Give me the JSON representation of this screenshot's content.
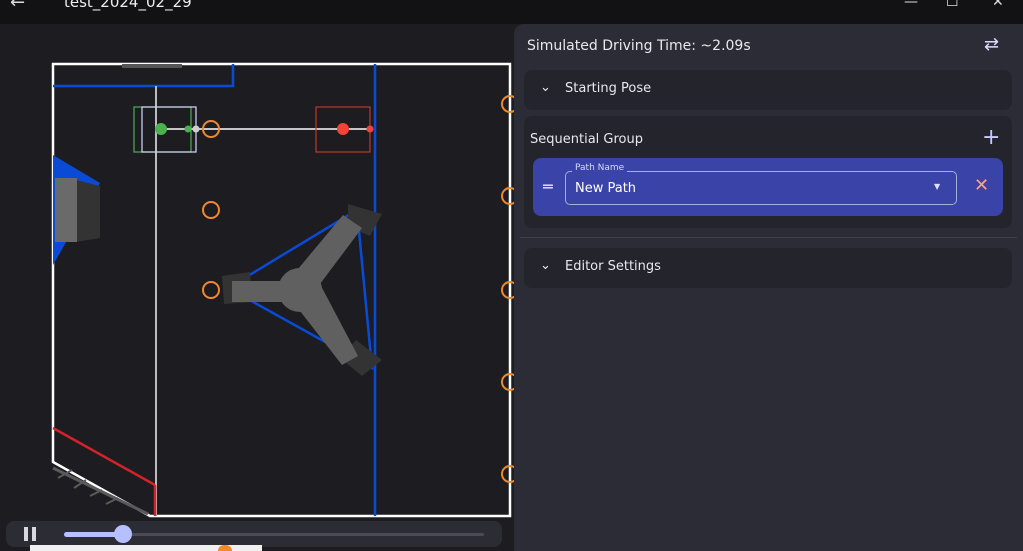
{
  "window": {
    "title": "test_2024_02_29",
    "back_icon": "arrow-left-icon",
    "minimize_glyph": "—",
    "maximize_glyph": "☐",
    "close_glyph": "✕"
  },
  "panel": {
    "simulated_time_label": "Simulated Driving Time: ~2.09s",
    "swap_icon": "swap-horizontal-icon",
    "sections": {
      "starting_pose": "Starting Pose",
      "editor_settings": "Editor Settings"
    },
    "sequential_group": {
      "title": "Sequential Group",
      "add_icon": "plus-icon",
      "path_item": {
        "field_label": "Path Name",
        "value": "New Path",
        "drag_icon": "drag-handle-icon",
        "remove_icon": "close-icon"
      }
    }
  },
  "playback": {
    "state": "playing",
    "progress": 0.14
  },
  "colors": {
    "accent": "#3a43a8",
    "blue_alliance": "#0a4bd6",
    "red_alliance": "#d2232a",
    "path_line": "#ffffff",
    "start_marker": "#4caf50",
    "end_marker": "#f44336",
    "waypoint_ring": "#f08a2a"
  }
}
